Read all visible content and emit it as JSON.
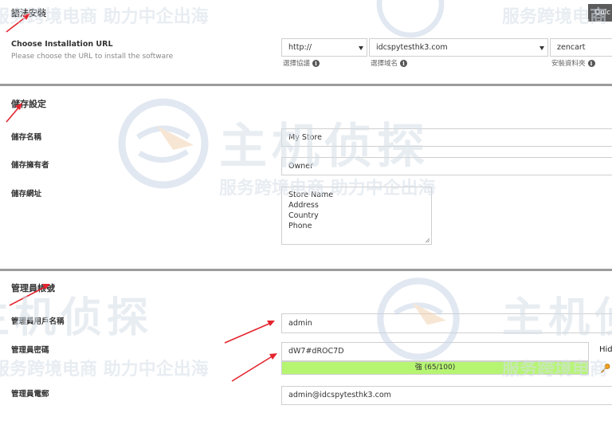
{
  "top_button": {
    "label": "Quic"
  },
  "language_section": {
    "title": "語法安裝"
  },
  "install_url": {
    "label": "Choose Installation URL",
    "hint": "Please choose the URL to install the software",
    "protocol": {
      "value": "http://",
      "sublabel": "選擇協議"
    },
    "domain": {
      "value": "idcspytesthk3.com",
      "sublabel": "選擇域名"
    },
    "directory": {
      "value": "zencart",
      "sublabel": "安裝資料夾"
    }
  },
  "store_section": {
    "title": "儲存設定",
    "store_name": {
      "label": "儲存名稱",
      "value": "My Store"
    },
    "store_owner": {
      "label": "儲存擁有者",
      "value": "Owner"
    },
    "store_address": {
      "label": "儲存網址",
      "lines": [
        "Store Name",
        "Address",
        "Country",
        "Phone"
      ]
    }
  },
  "admin_section": {
    "title": "管理員帳號",
    "username": {
      "label": "管理員用戶名稱",
      "value": "admin"
    },
    "password": {
      "label": "管理員密碼",
      "value": "dW7#dROC7D",
      "hide_label": "Hid",
      "strength_text": "強 (65/100)",
      "strength": 0.65
    },
    "email": {
      "label": "管理員電郵",
      "value": "admin@idcspytesthk3.com"
    }
  },
  "watermark": {
    "brand": "主机侦探",
    "slogan": "服务跨境电商 助力中企出海"
  },
  "colors": {
    "strength_bar": "#b6f572",
    "arrow": "#e4242e",
    "divider": "#9c9c9c"
  },
  "icons": [
    "info-icon",
    "key-icon",
    "chevron-down-icon",
    "resize-handle-icon",
    "watermark-logo-icon"
  ]
}
